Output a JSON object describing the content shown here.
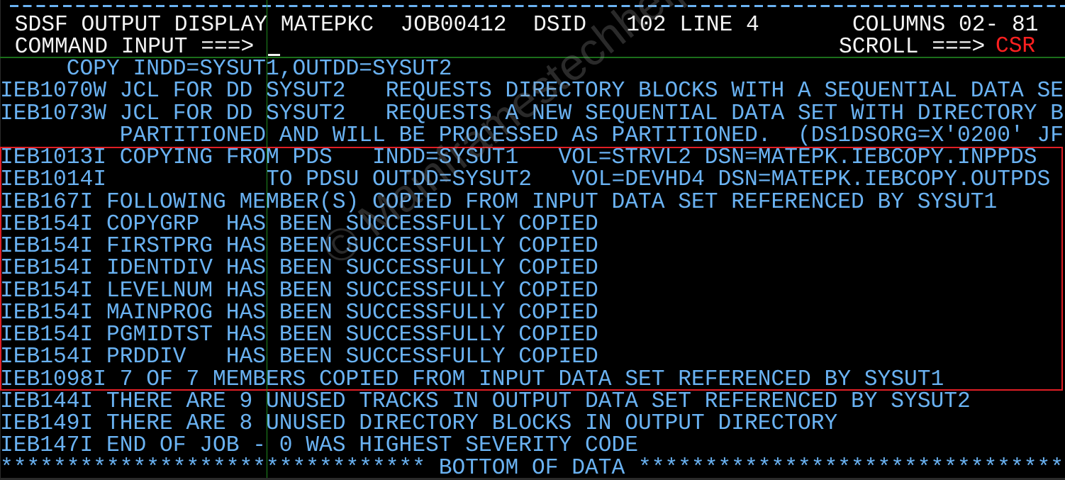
{
  "window": {
    "title": "SDSF OUTPUT DISPLAY"
  },
  "header": {
    "title": "SDSF OUTPUT DISPLAY",
    "jobname": "MATEPKC",
    "jobid": "JOB00412",
    "dsid_label": "DSID",
    "dsid_value": "102",
    "line_label": "LINE",
    "line_value": "4",
    "columns_label": "COLUMNS",
    "columns_value": "02- 81",
    "line1": " SDSF OUTPUT DISPLAY MATEPKC  JOB00412  DSID   102 LINE 4       COLUMNS 02- 81",
    "command_label": " COMMAND INPUT ===>",
    "command_value": "",
    "scroll_label": "SCROLL ===>",
    "scroll_value": "CSR"
  },
  "colors": {
    "background": "#000000",
    "header_text": "#f4f4f4",
    "output_text": "#6ab2f2",
    "scroll_value": "#ff2020",
    "highlight_box": "#e01e25",
    "guide_lines": "#1f8a1f"
  },
  "output_lines": [
    "     COPY INDD=SYSUT1,OUTDD=SYSUT2",
    "IEB1070W JCL FOR DD SYSUT2   REQUESTS DIRECTORY BLOCKS WITH A SEQUENTIAL DATA SE",
    "IEB1073W JCL FOR DD SYSUT2   REQUESTS A NEW SEQUENTIAL DATA SET WITH DIRECTORY B",
    "         PARTITIONED AND WILL BE PROCESSED AS PARTITIONED.  (DS1DSORG=X'0200' JF",
    "IEB1013I COPYING FROM PDS   INDD=SYSUT1   VOL=STRVL2 DSN=MATEPK.IEBCOPY.INPPDS",
    "IEB1014I            TO PDSU OUTDD=SYSUT2   VOL=DEVHD4 DSN=MATEPK.IEBCOPY.OUTPDS",
    "IEB167I FOLLOWING MEMBER(S) COPIED FROM INPUT DATA SET REFERENCED BY SYSUT1",
    "IEB154I COPYGRP  HAS BEEN SUCCESSFULLY COPIED",
    "IEB154I FIRSTPRG HAS BEEN SUCCESSFULLY COPIED",
    "IEB154I IDENTDIV HAS BEEN SUCCESSFULLY COPIED",
    "IEB154I LEVELNUM HAS BEEN SUCCESSFULLY COPIED",
    "IEB154I MAINPROG HAS BEEN SUCCESSFULLY COPIED",
    "IEB154I PGMIDTST HAS BEEN SUCCESSFULLY COPIED",
    "IEB154I PRDDIV   HAS BEEN SUCCESSFULLY COPIED",
    "IEB1098I 7 OF 7 MEMBERS COPIED FROM INPUT DATA SET REFERENCED BY SYSUT1",
    "IEB144I THERE ARE 9 UNUSED TRACKS IN OUTPUT DATA SET REFERENCED BY SYSUT2",
    "IEB149I THERE ARE 8 UNUSED DIRECTORY BLOCKS IN OUTPUT DIRECTORY",
    "IEB147I END OF JOB - 0 WAS HIGHEST SEVERITY CODE",
    "******************************** BOTTOM OF DATA ********************************"
  ],
  "highlight": {
    "first_line_index": 4,
    "last_line_index": 14
  },
  "members_copied": [
    "COPYGRP",
    "FIRSTPRG",
    "IDENTDIV",
    "LEVELNUM",
    "MAINPROG",
    "PGMIDTST",
    "PRDDIV"
  ],
  "watermark": "© Mainframestechhelp"
}
